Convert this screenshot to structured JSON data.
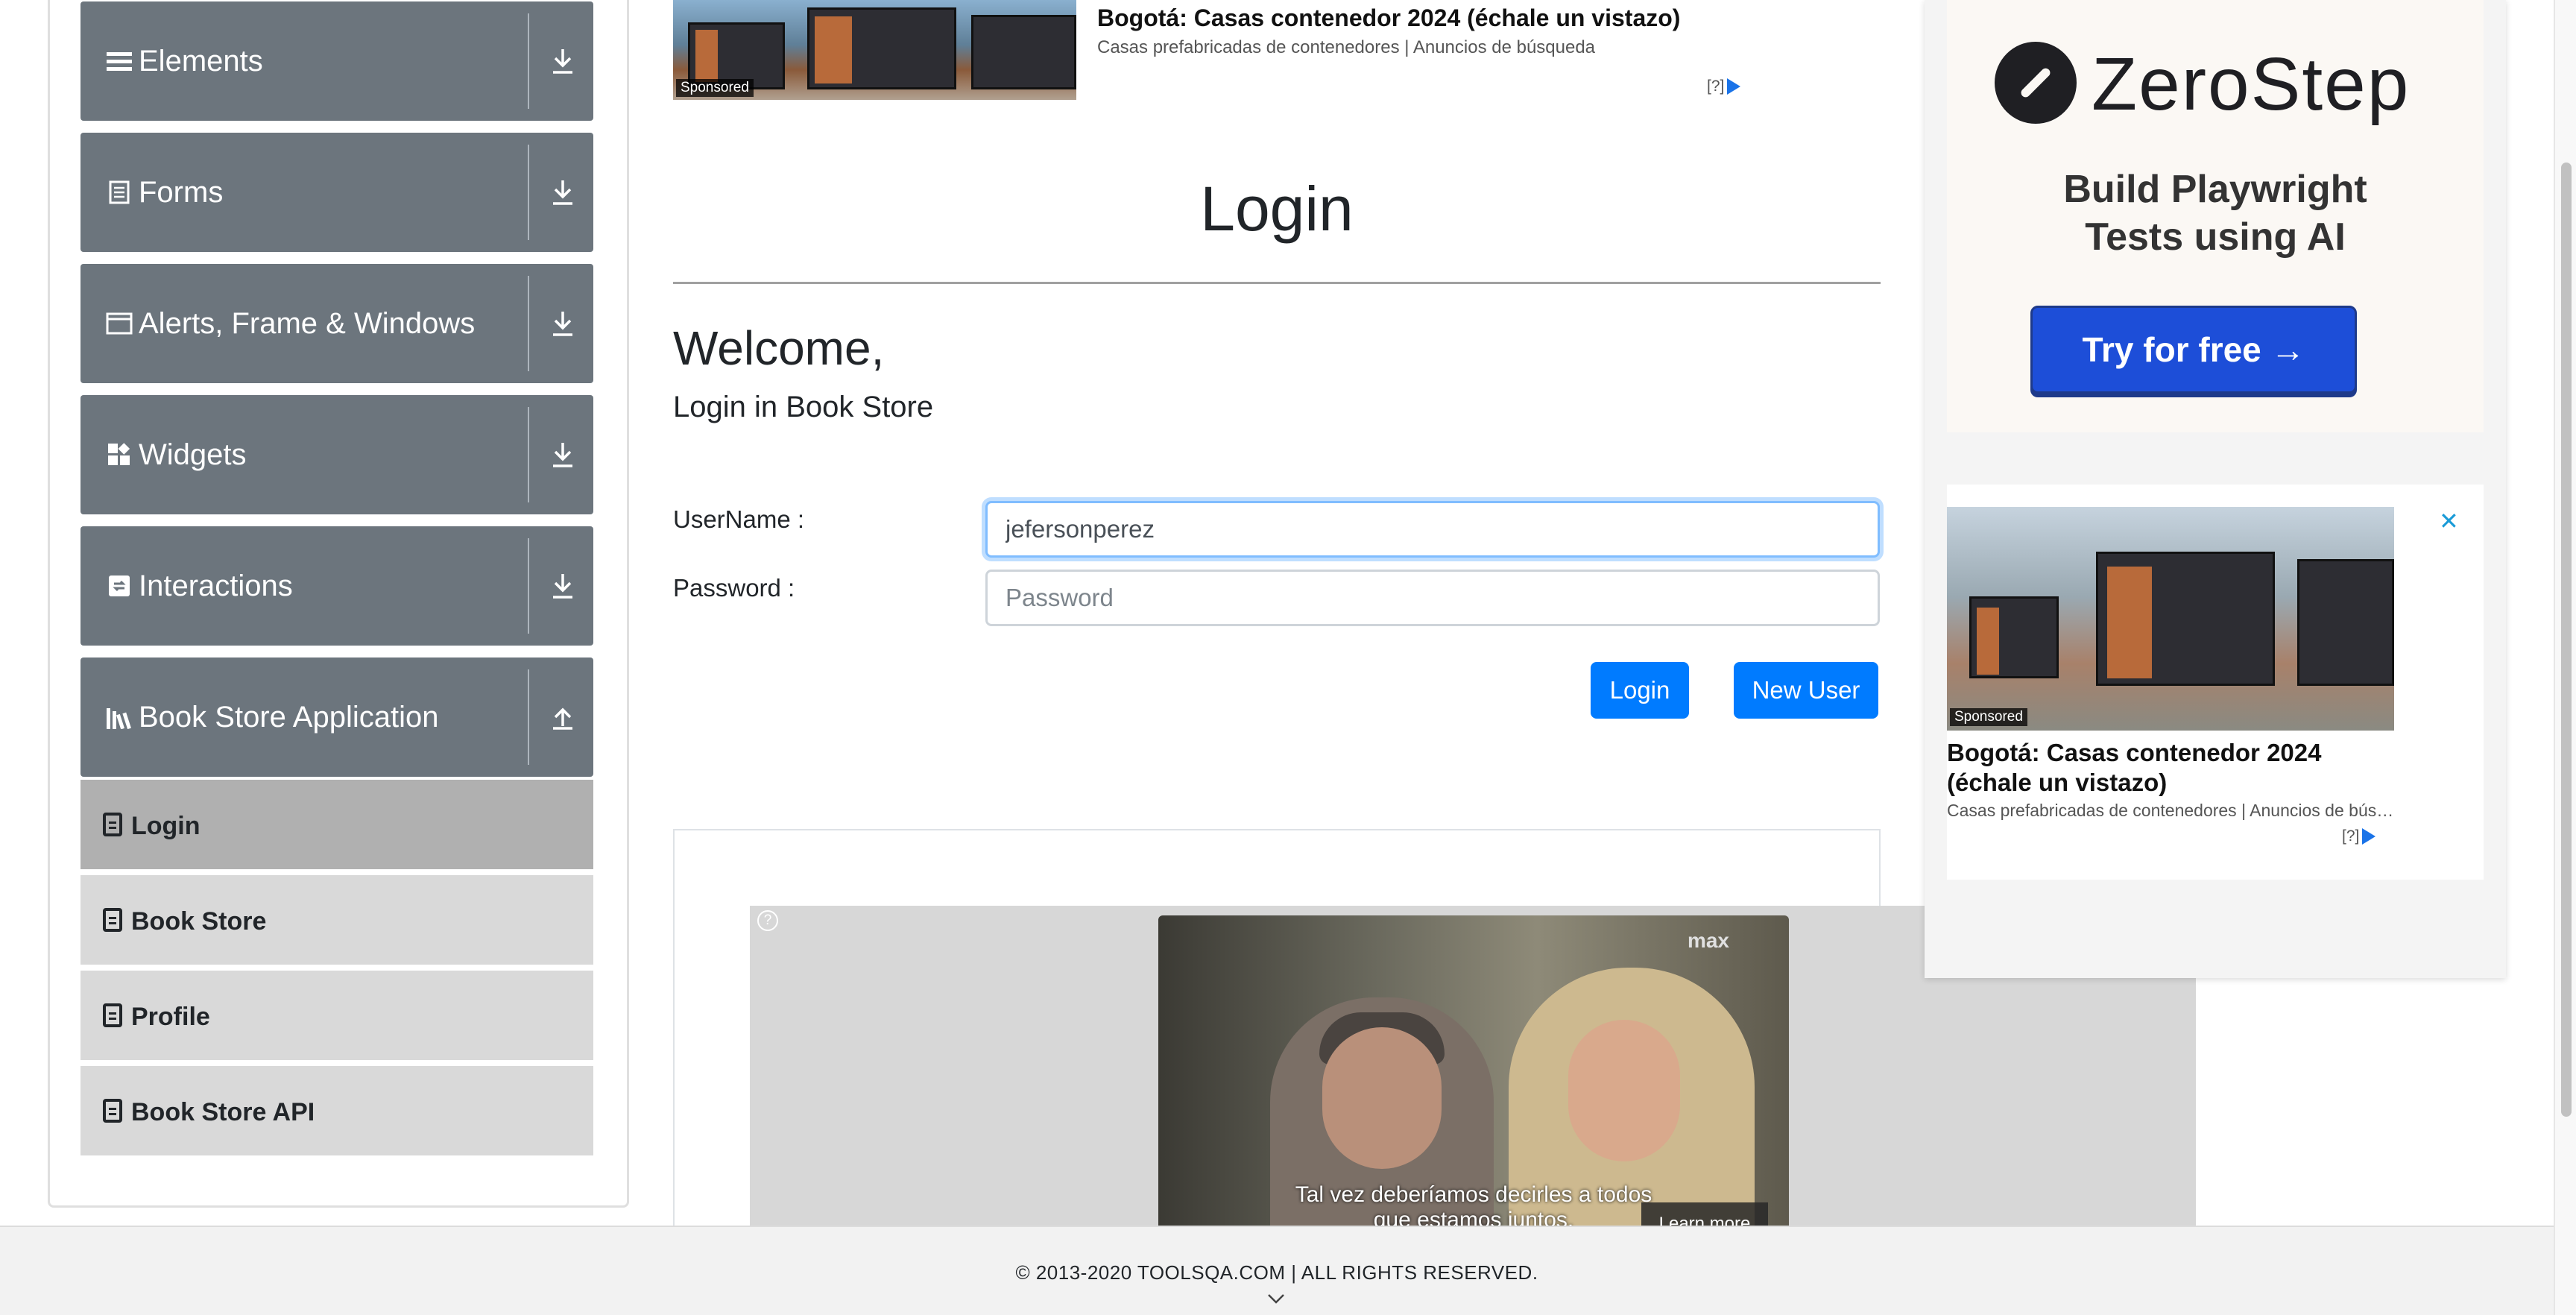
{
  "sidebar": {
    "groups": [
      {
        "label": "Elements",
        "icon": "hamburger-icon",
        "toggle": "expand-icon"
      },
      {
        "label": "Forms",
        "icon": "document-icon",
        "toggle": "expand-icon"
      },
      {
        "label": "Alerts, Frame & Windows",
        "icon": "window-icon",
        "toggle": "expand-icon"
      },
      {
        "label": "Widgets",
        "icon": "widgets-icon",
        "toggle": "expand-icon"
      },
      {
        "label": "Interactions",
        "icon": "interactions-icon",
        "toggle": "expand-icon"
      },
      {
        "label": "Book Store Application",
        "icon": "library-icon",
        "toggle": "collapse-icon"
      }
    ],
    "book_store_items": [
      {
        "label": "Login",
        "active": true
      },
      {
        "label": "Book Store",
        "active": false
      },
      {
        "label": "Profile",
        "active": false
      },
      {
        "label": "Book Store API",
        "active": false
      }
    ]
  },
  "top_ad": {
    "title": "Bogotá: Casas contenedor 2024 (échale un vistazo)",
    "subtitle": "Casas prefabricadas de contenedores | Anuncios de búsqueda",
    "sponsored": "Sponsored",
    "adchoice": "[?]"
  },
  "main": {
    "page_title": "Login",
    "welcome": "Welcome,",
    "welcome_sub": "Login in Book Store",
    "username_label": "UserName :",
    "username_value": "jefersonperez",
    "password_label": "Password :",
    "password_placeholder": "Password",
    "login_button": "Login",
    "new_user_button": "New User"
  },
  "video_ad": {
    "brand": "max",
    "caption_line1": "Tal vez deberíamos decirles a todos",
    "caption_line2": "que estamos juntos.",
    "learn_more": "Learn more",
    "help": "?"
  },
  "right_ad": {
    "brand": "ZeroStep",
    "tagline_line1": "Build Playwright",
    "tagline_line2": "Tests using AI",
    "cta": "Try for free →",
    "card_title": "Bogotá: Casas contenedor 2024 (échale un vistazo)",
    "card_subtitle": "Casas prefabricadas de contenedores | Anuncios de búsqueda",
    "sponsored": "Sponsored",
    "adchoice": "[?]",
    "close": "✕"
  },
  "footer": {
    "copyright": "© 2013-2020 TOOLSQA.COM | ALL RIGHTS RESERVED."
  },
  "colors": {
    "sidebar_header": "#6c757d",
    "sidebar_item": "#d9d9d9",
    "sidebar_item_active": "#b0b0b0",
    "primary": "#007bff",
    "cta_blue": "#1d4ed8"
  }
}
